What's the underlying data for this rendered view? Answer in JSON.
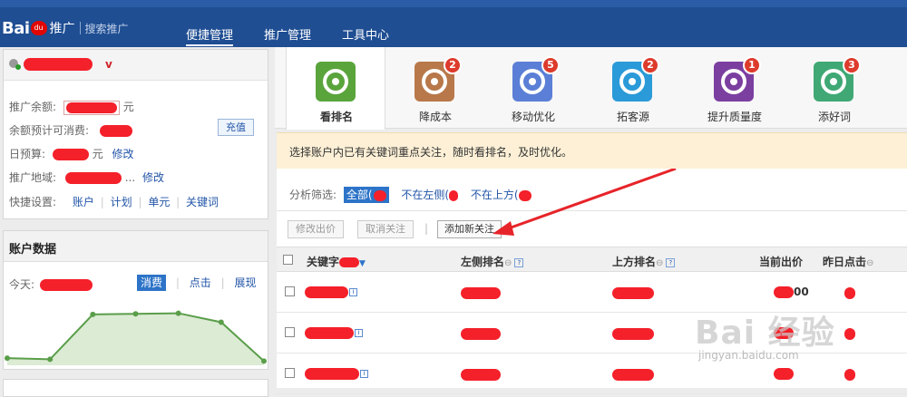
{
  "header": {
    "logo_text": "Bai",
    "logo_paw": "du",
    "logo_suffix": "推广",
    "logo_sub": "搜索推广",
    "nav": [
      "便捷管理",
      "推广管理",
      "工具中心"
    ]
  },
  "account": {
    "user_suffix": "v",
    "balance_label": "推广余额:",
    "balance_unit": "元",
    "est_label": "余额预计可消费:",
    "recharge": "充值",
    "budget_label": "日预算:",
    "budget_unit": "元",
    "edit": "修改",
    "region_label": "推广地域:",
    "region_more": "...",
    "shortcut_label": "快捷设置:",
    "shortcuts": [
      "账户",
      "计划",
      "单元",
      "关键词"
    ]
  },
  "account_data": {
    "title": "账户数据",
    "today_label": "今天:",
    "metrics": [
      "消费",
      "点击",
      "展现"
    ]
  },
  "chart_data": {
    "type": "area",
    "x": [
      1,
      2,
      3,
      4,
      5,
      6,
      7
    ],
    "values": [
      0.12,
      0.1,
      0.85,
      0.86,
      0.87,
      0.72,
      0.07
    ],
    "ylim": [
      0,
      1
    ],
    "grid": false,
    "line_color": "#5a9e4a",
    "fill_color": "#dcebd4"
  },
  "tools": [
    {
      "label": "看排名",
      "badge": "",
      "icon": "target-icon",
      "color": "#5aa43c"
    },
    {
      "label": "降成本",
      "badge": "2",
      "icon": "piggy-bank-icon",
      "color": "#b8784a"
    },
    {
      "label": "移动优化",
      "badge": "5",
      "icon": "mobile-check-icon",
      "color": "#5b7fd6"
    },
    {
      "label": "拓客源",
      "badge": "2",
      "icon": "magnifier-icon",
      "color": "#2a9ad8"
    },
    {
      "label": "提升质量度",
      "badge": "1",
      "icon": "stars-icon",
      "color": "#7b3fa0"
    },
    {
      "label": "添好词",
      "badge": "3",
      "icon": "word-icon",
      "color": "#3fa874"
    }
  ],
  "notice": "选择账户内已有关键词重点关注，随时看排名，及时优化。",
  "filter": {
    "label": "分析筛选:",
    "options": [
      "全部(",
      "不在左侧(",
      "不在上方("
    ]
  },
  "toolbar": {
    "edit_bid": "修改出价",
    "unfollow": "取消关注",
    "add_follow": "添加新关注"
  },
  "table": {
    "headers": [
      "关键字",
      "左侧排名",
      "上方排名",
      "当前出价",
      "昨日点击"
    ],
    "bid_visible": "00",
    "row_count": 3
  },
  "watermark": {
    "text": "Bai 经验",
    "url": "jingyan.baidu.com"
  }
}
